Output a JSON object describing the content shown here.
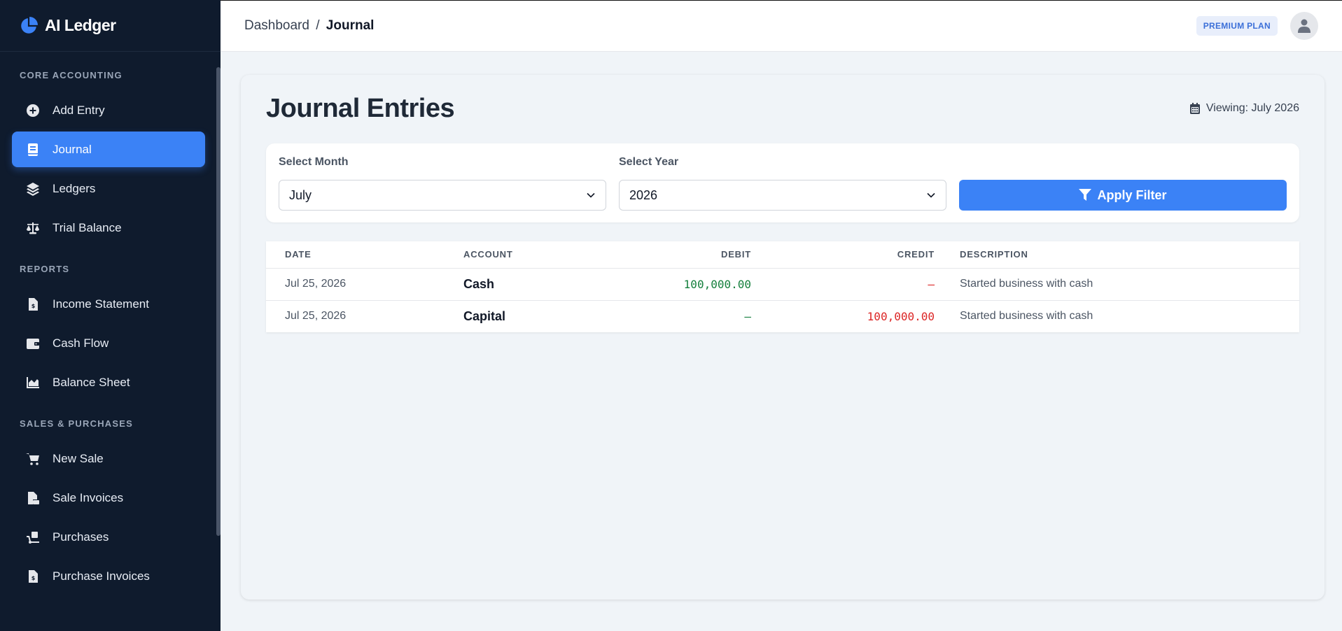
{
  "brand": {
    "name": "AI Ledger"
  },
  "sidebar": {
    "sections": [
      {
        "title": "CORE ACCOUNTING",
        "items": [
          {
            "label": "Add Entry",
            "icon": "plus-circle-icon",
            "active": false
          },
          {
            "label": "Journal",
            "icon": "book-icon",
            "active": true
          },
          {
            "label": "Ledgers",
            "icon": "layers-icon",
            "active": false
          },
          {
            "label": "Trial Balance",
            "icon": "scale-icon",
            "active": false
          }
        ]
      },
      {
        "title": "REPORTS",
        "items": [
          {
            "label": "Income Statement",
            "icon": "invoice-dollar-icon",
            "active": false
          },
          {
            "label": "Cash Flow",
            "icon": "wallet-icon",
            "active": false
          },
          {
            "label": "Balance Sheet",
            "icon": "chart-area-icon",
            "active": false
          }
        ]
      },
      {
        "title": "SALES & PURCHASES",
        "items": [
          {
            "label": "New Sale",
            "icon": "cart-icon",
            "active": false
          },
          {
            "label": "Sale Invoices",
            "icon": "file-invoice-icon",
            "active": false
          },
          {
            "label": "Purchases",
            "icon": "dolly-icon",
            "active": false
          },
          {
            "label": "Purchase Invoices",
            "icon": "invoice-dollar-icon",
            "active": false
          }
        ]
      }
    ]
  },
  "topbar": {
    "breadcrumb_root": "Dashboard",
    "breadcrumb_sep": "/",
    "breadcrumb_current": "Journal",
    "plan_badge": "PREMIUM PLAN"
  },
  "page": {
    "title": "Journal Entries",
    "viewing": "Viewing: July 2026"
  },
  "filter": {
    "month_label": "Select Month",
    "month_value": "July",
    "year_label": "Select Year",
    "year_value": "2026",
    "apply_label": "Apply Filter"
  },
  "table": {
    "headers": {
      "date": "DATE",
      "account": "ACCOUNT",
      "debit": "DEBIT",
      "credit": "CREDIT",
      "description": "DESCRIPTION"
    },
    "rows": [
      {
        "date": "Jul 25, 2026",
        "account": "Cash",
        "debit": "100,000.00",
        "credit": "–",
        "description": "Started business with cash"
      },
      {
        "date": "Jul 25, 2026",
        "account": "Capital",
        "debit": "–",
        "credit": "100,000.00",
        "description": "Started business with cash"
      }
    ]
  },
  "colors": {
    "sidebar_bg": "#0f1b2d",
    "accent": "#3b82f6",
    "debit": "#15803d",
    "credit": "#dc2626"
  }
}
